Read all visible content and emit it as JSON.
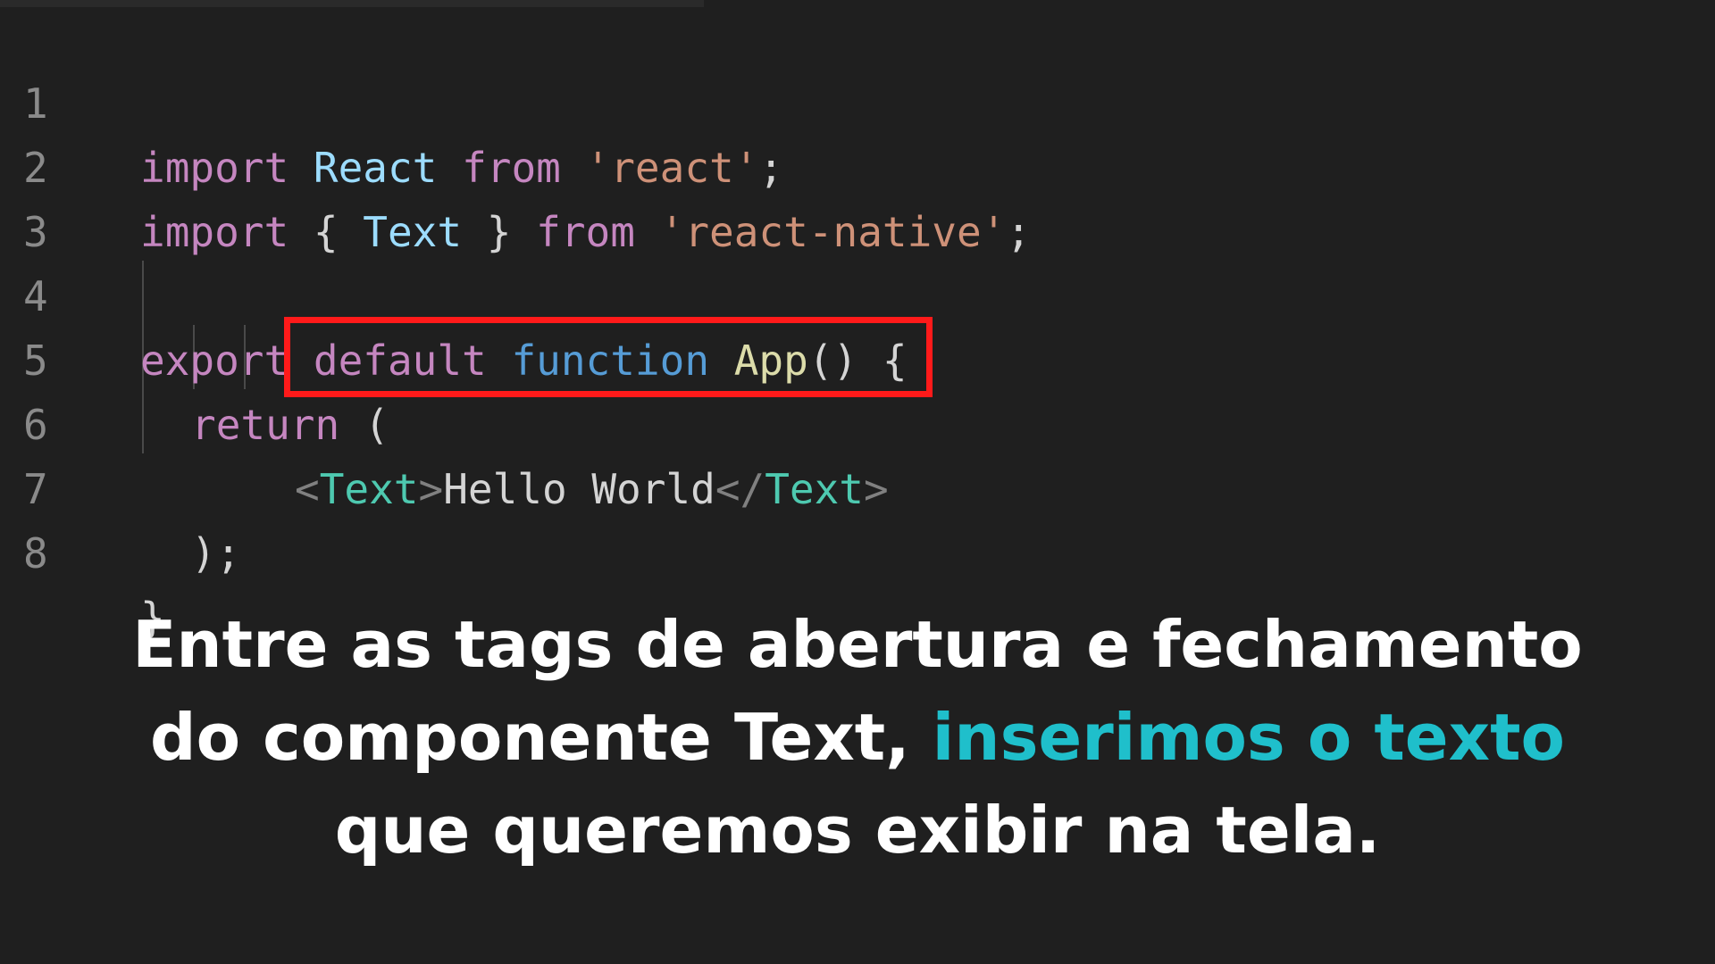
{
  "editor": {
    "lines": [
      {
        "number": "1",
        "tokens": [
          "import",
          "React",
          "from",
          "'react'",
          ";"
        ]
      },
      {
        "number": "2",
        "tokens": [
          "import",
          "{",
          "Text",
          "}",
          "from",
          "'react-native'",
          ";"
        ]
      },
      {
        "number": "3",
        "tokens": []
      },
      {
        "number": "4",
        "tokens": [
          "export",
          "default",
          "function",
          "App",
          "()",
          "{"
        ]
      },
      {
        "number": "5",
        "tokens": [
          "return",
          "("
        ]
      },
      {
        "number": "6",
        "tokens": [
          "<",
          "Text",
          ">",
          "Hello World",
          "</",
          "Text",
          ">"
        ]
      },
      {
        "number": "7",
        "tokens": [
          ");"
        ]
      },
      {
        "number": "8",
        "tokens": [
          "}"
        ]
      }
    ]
  },
  "caption": {
    "line1": "Entre as tags de abertura e fechamento",
    "line2_before": "do componente Text, ",
    "line2_accent": "inserimos o texto",
    "line3": "que queremos exibir na tela."
  },
  "colors": {
    "background": "#1f1f1f",
    "keyword": "#c586c0",
    "string": "#ce9178",
    "type": "#4ec9b0",
    "function_name": "#dcdcaa",
    "storage": "#569cd6",
    "highlight_border": "#ff1a1a",
    "caption_accent": "#1fbfcb"
  }
}
